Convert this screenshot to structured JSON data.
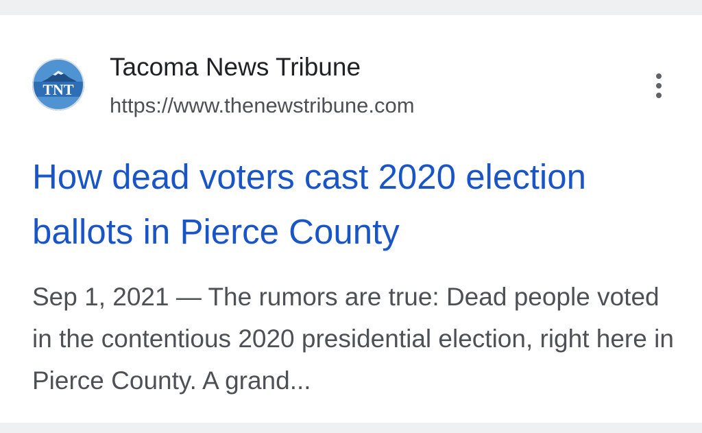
{
  "result": {
    "favicon": {
      "icon": "tnt-logo-icon",
      "text": "TNT",
      "colors": {
        "sky": "#4f93d2",
        "mountain": "#1f4f86",
        "band": "#2d6eb5",
        "letters": "#ffffff"
      }
    },
    "site_name": "Tacoma News Tribune",
    "url": "https://www.thenewstribune.com",
    "menu_icon": "more-vert-icon",
    "headline": "How dead voters cast 2020 election ballots in Pierce County",
    "snippet": "Sep 1, 2021 — The rumors are true: Dead people voted in the contentious 2020 presidential election, right here in Pierce County. A grand..."
  },
  "colors": {
    "headline": "#1a55c7",
    "title": "#202124",
    "secondary": "#4d5156",
    "background": "#eef0f2",
    "card": "#ffffff"
  }
}
